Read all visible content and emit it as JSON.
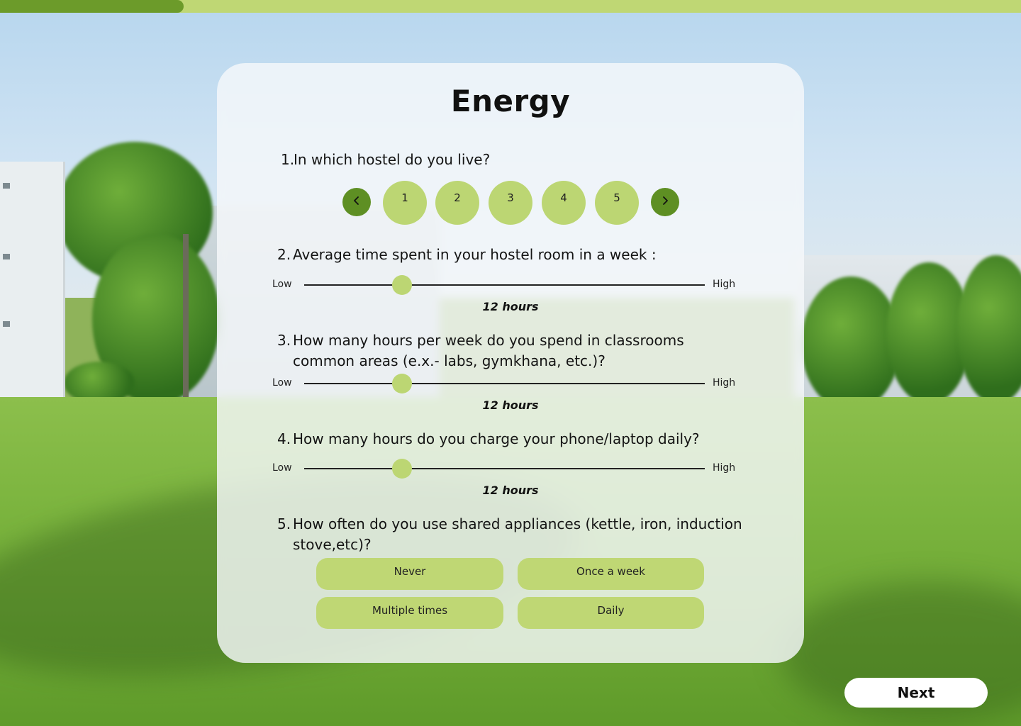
{
  "progress": {
    "fraction": 0.18
  },
  "page": {
    "title": "Energy"
  },
  "questions": [
    {
      "num": "1.",
      "text": "In which hostel do you live?"
    },
    {
      "num": "2.",
      "text": "Average time spent in your hostel room in a week :"
    },
    {
      "num": "3.",
      "line1": "How many hours per week do you spend in classrooms",
      "line2": "common areas (e.x.- labs, gymkhana, etc.)?"
    },
    {
      "num": "4.",
      "text": "How many hours do you charge your phone/laptop daily?"
    },
    {
      "num": "5.",
      "line1": "How often do you use shared appliances (kettle, iron, induction",
      "line2": "stove,etc)?"
    }
  ],
  "hostels": {
    "prev_icon": "chevron-left-icon",
    "next_icon": "chevron-right-icon",
    "options": [
      "1",
      "2",
      "3",
      "4",
      "5"
    ]
  },
  "sliders": [
    {
      "low": "Low",
      "high": "High",
      "value_label": "12 hours",
      "level": 0.245
    },
    {
      "low": "Low",
      "high": "High",
      "value_label": "12 hours",
      "level": 0.245
    },
    {
      "low": "Low",
      "high": "High",
      "value_label": "12 hours",
      "level": 0.245
    }
  ],
  "appliance_options": [
    "Never",
    "Once a week",
    "Multiple times",
    "Daily"
  ],
  "footer": {
    "next_label": "Next"
  },
  "colors": {
    "accent": "#bcd673",
    "accent_dark": "#5e8f23",
    "progress_track": "#bfd774",
    "progress_fill": "#6c9b2a"
  }
}
